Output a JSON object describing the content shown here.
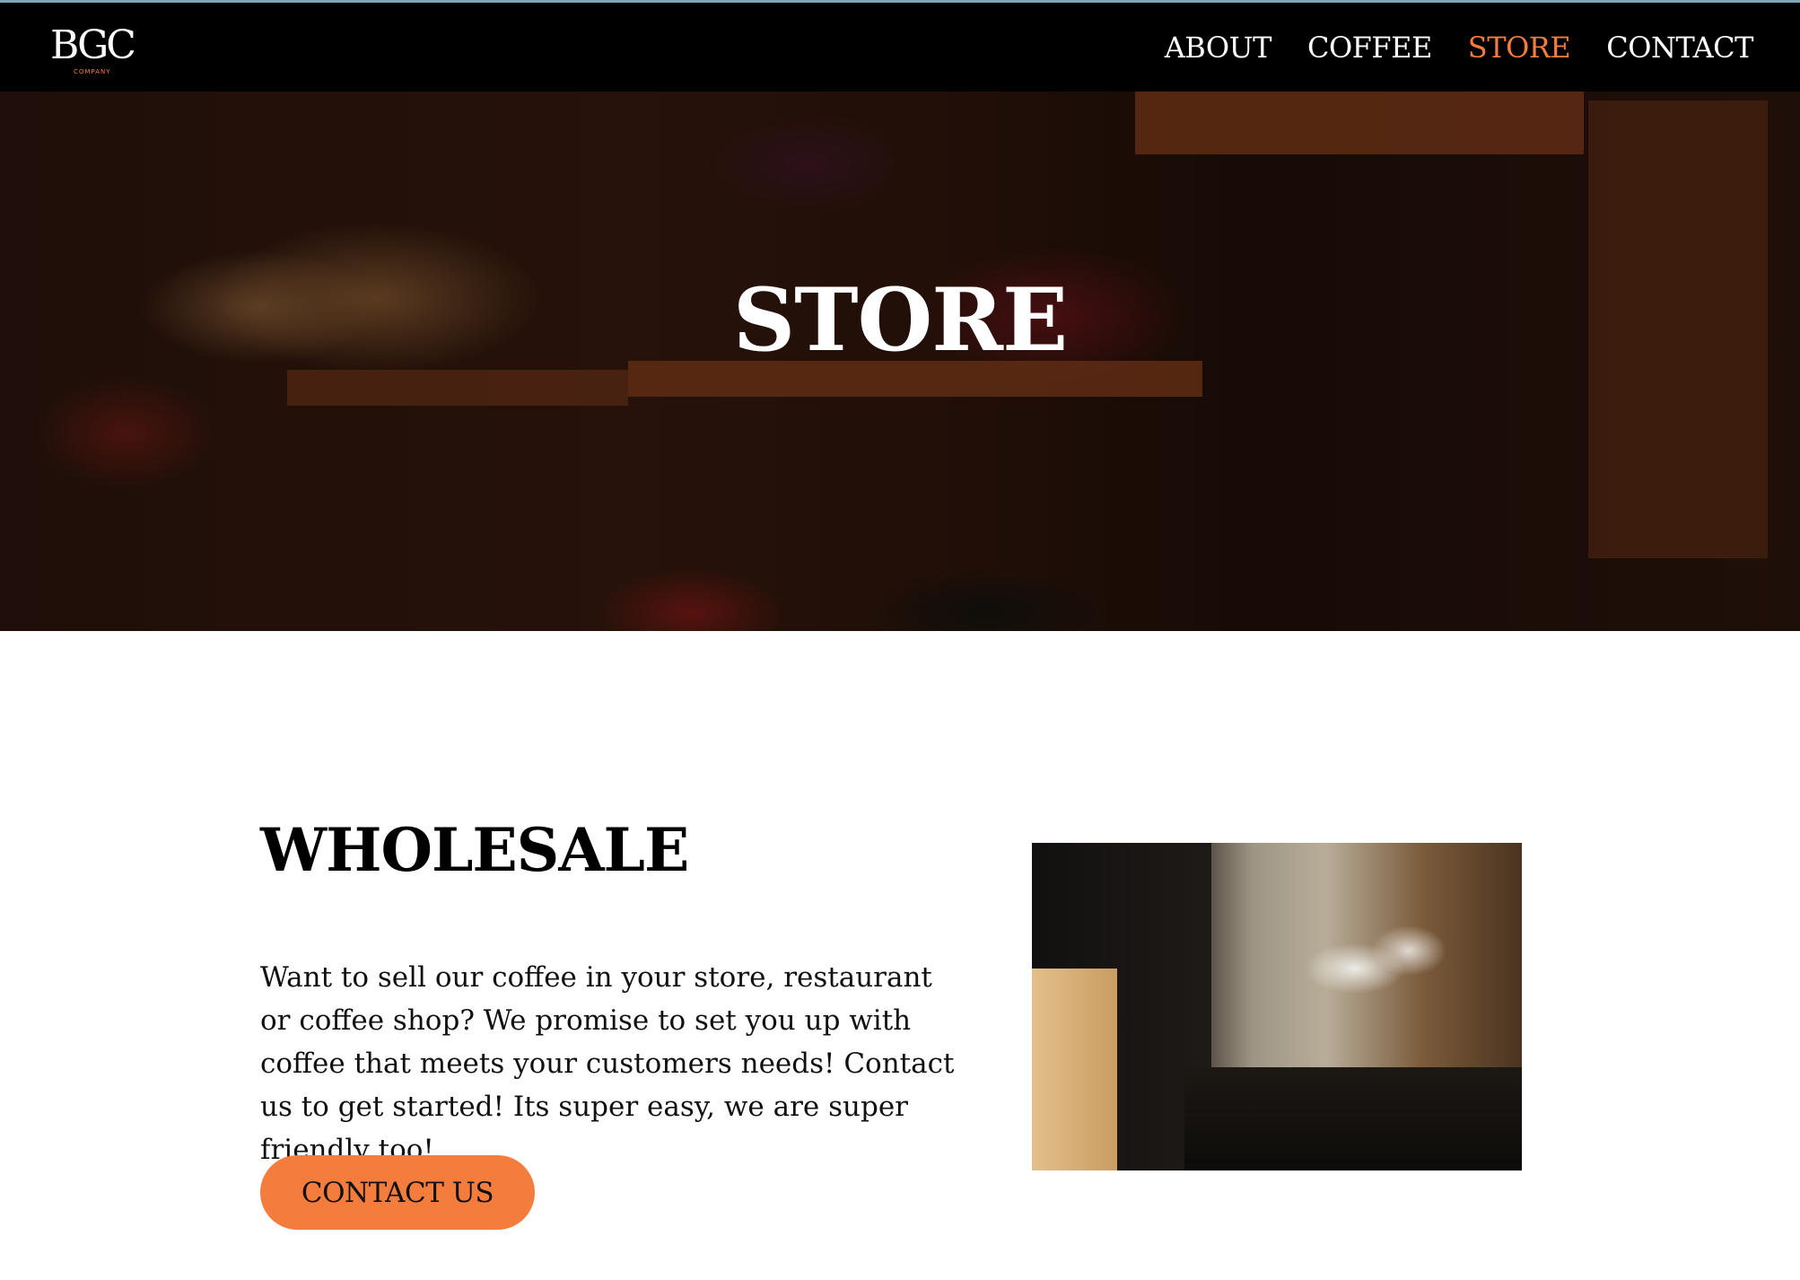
{
  "navbar": {
    "logo_text": "BGC",
    "logo_subtext": "COMPANY",
    "links": [
      {
        "label": "ABOUT",
        "active": false
      },
      {
        "label": "COFFEE",
        "active": false
      },
      {
        "label": "STORE",
        "active": true
      },
      {
        "label": "CONTACT",
        "active": false
      }
    ]
  },
  "hero": {
    "title": "STORE",
    "image": "produce-market-photo"
  },
  "wholesale": {
    "title": "WHOLESALE",
    "body": "Want to sell our coffee in your store, restaurant or coffee shop? We promise to set you up with coffee that meets your customers needs! Contact us to get started! Its super easy, we are super friendly too!",
    "button_label": "CONTACT US",
    "image": "barista-pour-over-photo"
  },
  "colors": {
    "accent": "#f47c3c",
    "navbar_bg": "#000000",
    "text": "#000000"
  }
}
